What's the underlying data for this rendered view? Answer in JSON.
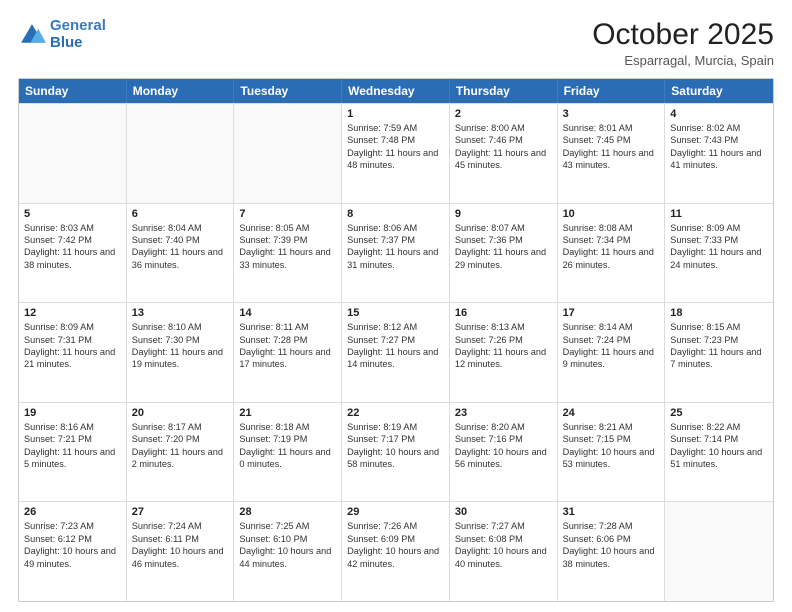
{
  "header": {
    "logo_line1": "General",
    "logo_line2": "Blue",
    "month": "October 2025",
    "location": "Esparragal, Murcia, Spain"
  },
  "days_of_week": [
    "Sunday",
    "Monday",
    "Tuesday",
    "Wednesday",
    "Thursday",
    "Friday",
    "Saturday"
  ],
  "weeks": [
    [
      {
        "day": "",
        "sunrise": "",
        "sunset": "",
        "daylight": ""
      },
      {
        "day": "",
        "sunrise": "",
        "sunset": "",
        "daylight": ""
      },
      {
        "day": "",
        "sunrise": "",
        "sunset": "",
        "daylight": ""
      },
      {
        "day": "1",
        "sunrise": "Sunrise: 7:59 AM",
        "sunset": "Sunset: 7:48 PM",
        "daylight": "Daylight: 11 hours and 48 minutes."
      },
      {
        "day": "2",
        "sunrise": "Sunrise: 8:00 AM",
        "sunset": "Sunset: 7:46 PM",
        "daylight": "Daylight: 11 hours and 45 minutes."
      },
      {
        "day": "3",
        "sunrise": "Sunrise: 8:01 AM",
        "sunset": "Sunset: 7:45 PM",
        "daylight": "Daylight: 11 hours and 43 minutes."
      },
      {
        "day": "4",
        "sunrise": "Sunrise: 8:02 AM",
        "sunset": "Sunset: 7:43 PM",
        "daylight": "Daylight: 11 hours and 41 minutes."
      }
    ],
    [
      {
        "day": "5",
        "sunrise": "Sunrise: 8:03 AM",
        "sunset": "Sunset: 7:42 PM",
        "daylight": "Daylight: 11 hours and 38 minutes."
      },
      {
        "day": "6",
        "sunrise": "Sunrise: 8:04 AM",
        "sunset": "Sunset: 7:40 PM",
        "daylight": "Daylight: 11 hours and 36 minutes."
      },
      {
        "day": "7",
        "sunrise": "Sunrise: 8:05 AM",
        "sunset": "Sunset: 7:39 PM",
        "daylight": "Daylight: 11 hours and 33 minutes."
      },
      {
        "day": "8",
        "sunrise": "Sunrise: 8:06 AM",
        "sunset": "Sunset: 7:37 PM",
        "daylight": "Daylight: 11 hours and 31 minutes."
      },
      {
        "day": "9",
        "sunrise": "Sunrise: 8:07 AM",
        "sunset": "Sunset: 7:36 PM",
        "daylight": "Daylight: 11 hours and 29 minutes."
      },
      {
        "day": "10",
        "sunrise": "Sunrise: 8:08 AM",
        "sunset": "Sunset: 7:34 PM",
        "daylight": "Daylight: 11 hours and 26 minutes."
      },
      {
        "day": "11",
        "sunrise": "Sunrise: 8:09 AM",
        "sunset": "Sunset: 7:33 PM",
        "daylight": "Daylight: 11 hours and 24 minutes."
      }
    ],
    [
      {
        "day": "12",
        "sunrise": "Sunrise: 8:09 AM",
        "sunset": "Sunset: 7:31 PM",
        "daylight": "Daylight: 11 hours and 21 minutes."
      },
      {
        "day": "13",
        "sunrise": "Sunrise: 8:10 AM",
        "sunset": "Sunset: 7:30 PM",
        "daylight": "Daylight: 11 hours and 19 minutes."
      },
      {
        "day": "14",
        "sunrise": "Sunrise: 8:11 AM",
        "sunset": "Sunset: 7:28 PM",
        "daylight": "Daylight: 11 hours and 17 minutes."
      },
      {
        "day": "15",
        "sunrise": "Sunrise: 8:12 AM",
        "sunset": "Sunset: 7:27 PM",
        "daylight": "Daylight: 11 hours and 14 minutes."
      },
      {
        "day": "16",
        "sunrise": "Sunrise: 8:13 AM",
        "sunset": "Sunset: 7:26 PM",
        "daylight": "Daylight: 11 hours and 12 minutes."
      },
      {
        "day": "17",
        "sunrise": "Sunrise: 8:14 AM",
        "sunset": "Sunset: 7:24 PM",
        "daylight": "Daylight: 11 hours and 9 minutes."
      },
      {
        "day": "18",
        "sunrise": "Sunrise: 8:15 AM",
        "sunset": "Sunset: 7:23 PM",
        "daylight": "Daylight: 11 hours and 7 minutes."
      }
    ],
    [
      {
        "day": "19",
        "sunrise": "Sunrise: 8:16 AM",
        "sunset": "Sunset: 7:21 PM",
        "daylight": "Daylight: 11 hours and 5 minutes."
      },
      {
        "day": "20",
        "sunrise": "Sunrise: 8:17 AM",
        "sunset": "Sunset: 7:20 PM",
        "daylight": "Daylight: 11 hours and 2 minutes."
      },
      {
        "day": "21",
        "sunrise": "Sunrise: 8:18 AM",
        "sunset": "Sunset: 7:19 PM",
        "daylight": "Daylight: 11 hours and 0 minutes."
      },
      {
        "day": "22",
        "sunrise": "Sunrise: 8:19 AM",
        "sunset": "Sunset: 7:17 PM",
        "daylight": "Daylight: 10 hours and 58 minutes."
      },
      {
        "day": "23",
        "sunrise": "Sunrise: 8:20 AM",
        "sunset": "Sunset: 7:16 PM",
        "daylight": "Daylight: 10 hours and 56 minutes."
      },
      {
        "day": "24",
        "sunrise": "Sunrise: 8:21 AM",
        "sunset": "Sunset: 7:15 PM",
        "daylight": "Daylight: 10 hours and 53 minutes."
      },
      {
        "day": "25",
        "sunrise": "Sunrise: 8:22 AM",
        "sunset": "Sunset: 7:14 PM",
        "daylight": "Daylight: 10 hours and 51 minutes."
      }
    ],
    [
      {
        "day": "26",
        "sunrise": "Sunrise: 7:23 AM",
        "sunset": "Sunset: 6:12 PM",
        "daylight": "Daylight: 10 hours and 49 minutes."
      },
      {
        "day": "27",
        "sunrise": "Sunrise: 7:24 AM",
        "sunset": "Sunset: 6:11 PM",
        "daylight": "Daylight: 10 hours and 46 minutes."
      },
      {
        "day": "28",
        "sunrise": "Sunrise: 7:25 AM",
        "sunset": "Sunset: 6:10 PM",
        "daylight": "Daylight: 10 hours and 44 minutes."
      },
      {
        "day": "29",
        "sunrise": "Sunrise: 7:26 AM",
        "sunset": "Sunset: 6:09 PM",
        "daylight": "Daylight: 10 hours and 42 minutes."
      },
      {
        "day": "30",
        "sunrise": "Sunrise: 7:27 AM",
        "sunset": "Sunset: 6:08 PM",
        "daylight": "Daylight: 10 hours and 40 minutes."
      },
      {
        "day": "31",
        "sunrise": "Sunrise: 7:28 AM",
        "sunset": "Sunset: 6:06 PM",
        "daylight": "Daylight: 10 hours and 38 minutes."
      },
      {
        "day": "",
        "sunrise": "",
        "sunset": "",
        "daylight": ""
      }
    ]
  ]
}
